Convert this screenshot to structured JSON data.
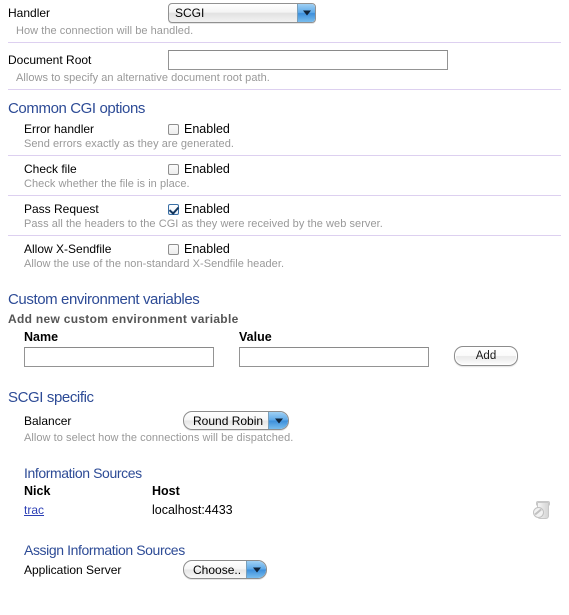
{
  "handler": {
    "label": "Handler",
    "value": "SCGI",
    "comment": "How the connection will be handled."
  },
  "document_root": {
    "label": "Document Root",
    "value": "",
    "comment": "Allows to specify an alternative document root path."
  },
  "common_cgi": {
    "heading": "Common CGI options",
    "options": [
      {
        "label": "Error handler",
        "checkbox_label": "Enabled",
        "checked": false,
        "comment": "Send errors exactly as they are generated."
      },
      {
        "label": "Check file",
        "checkbox_label": "Enabled",
        "checked": false,
        "comment": "Check whether the file is in place."
      },
      {
        "label": "Pass Request",
        "checkbox_label": "Enabled",
        "checked": true,
        "comment": "Pass all the headers to the CGI as they were received by the web server."
      },
      {
        "label": "Allow X-Sendfile",
        "checkbox_label": "Enabled",
        "checked": false,
        "comment": "Allow the use of the non-standard X-Sendfile header."
      }
    ]
  },
  "custom_env": {
    "heading": "Custom environment variables",
    "subheading": "Add new custom environment variable",
    "name_label": "Name",
    "name_value": "",
    "value_label": "Value",
    "value_value": "",
    "add_label": "Add"
  },
  "scgi_specific": {
    "heading": "SCGI specific",
    "balancer_label": "Balancer",
    "balancer_value": "Round Robin",
    "balancer_comment": "Allow to select how the connections will be dispatched."
  },
  "information_sources": {
    "heading": "Information Sources",
    "columns": [
      "Nick",
      "Host"
    ],
    "rows": [
      {
        "nick": "trac",
        "host": "localhost:4433",
        "action_icon": "trash-disabled-icon"
      }
    ]
  },
  "assign_information_sources": {
    "heading": "Assign Information Sources",
    "app_server_label": "Application Server",
    "app_server_value": "Choose.."
  },
  "colors": {
    "heading_blue": "#2d4b96",
    "separator": "#ddd0f0",
    "comment_gray": "#999999",
    "link_blue": "#2c3fb5",
    "arrow_blue": "#3d8fdb"
  }
}
